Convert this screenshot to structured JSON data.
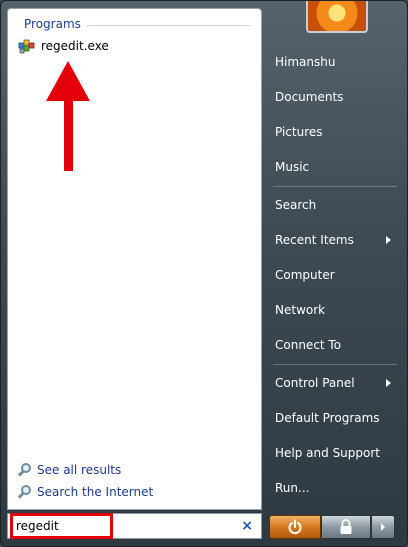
{
  "left_pane": {
    "section_header": "Programs",
    "programs": [
      {
        "label": "regedit.exe",
        "icon": "regedit-icon"
      }
    ],
    "see_all_results": "See all results",
    "search_internet": "Search the Internet"
  },
  "search": {
    "value": "regedit"
  },
  "right_pane": {
    "items": [
      {
        "label": "Himanshu"
      },
      {
        "label": "Documents"
      },
      {
        "label": "Pictures"
      },
      {
        "label": "Music"
      },
      {
        "label": "Search"
      },
      {
        "label": "Recent Items"
      },
      {
        "label": "Computer"
      },
      {
        "label": "Network"
      },
      {
        "label": "Connect To"
      },
      {
        "label": "Control Panel"
      },
      {
        "label": "Default Programs"
      },
      {
        "label": "Help and Support"
      },
      {
        "label": "Run..."
      }
    ]
  },
  "colors": {
    "annotation": "#e3000b",
    "link": "#1c3b8c",
    "header": "#1e3f94",
    "power_button": "#d57a1e"
  }
}
